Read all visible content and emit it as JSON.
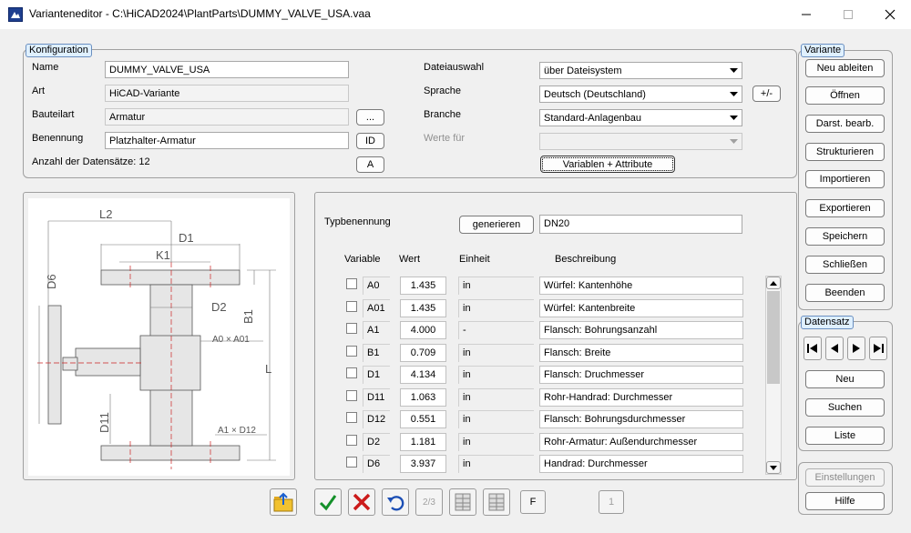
{
  "window": {
    "title": "Varianteneditor - C:\\HiCAD2024\\PlantParts\\DUMMY_VALVE_USA.vaa"
  },
  "konfiguration": {
    "group_label": "Konfiguration",
    "name_label": "Name",
    "name_value": "DUMMY_VALVE_USA",
    "art_label": "Art",
    "art_value": "HiCAD-Variante",
    "bauteilart_label": "Bauteilart",
    "bauteilart_value": "Armatur",
    "bauteilart_btn": "...",
    "benennung_label": "Benennung",
    "benennung_value": "Platzhalter-Armatur",
    "benennung_btn": "ID",
    "anzahl_label": "Anzahl der Datensätze: 12",
    "anzahl_btn": "A",
    "dateiauswahl_label": "Dateiauswahl",
    "dateiauswahl_value": "über Dateisystem",
    "sprache_label": "Sprache",
    "sprache_value": "Deutsch (Deutschland)",
    "sprache_btn": "+/-",
    "branche_label": "Branche",
    "branche_value": "Standard-Anlagenbau",
    "werte_label": "Werte für",
    "werte_value": "",
    "variablen_btn": "Variablen + Attribute"
  },
  "drawing": {
    "dims": [
      "L2",
      "D1",
      "K1",
      "D6",
      "D2",
      "B1",
      "A0 × A01",
      "L",
      "D11",
      "A1 × D12"
    ]
  },
  "variables": {
    "typ_label": "Typbenennung",
    "generieren_btn": "generieren",
    "typ_value": "DN20",
    "headers": {
      "variable": "Variable",
      "wert": "Wert",
      "einheit": "Einheit",
      "beschreibung": "Beschreibung"
    },
    "rows": [
      {
        "name": "A0",
        "value": "1.435",
        "unit": "in",
        "desc": "Würfel: Kantenhöhe"
      },
      {
        "name": "A01",
        "value": "1.435",
        "unit": "in",
        "desc": "Würfel: Kantenbreite"
      },
      {
        "name": "A1",
        "value": "4.000",
        "unit": "-",
        "desc": "Flansch: Bohrungsanzahl"
      },
      {
        "name": "B1",
        "value": "0.709",
        "unit": "in",
        "desc": "Flansch: Breite"
      },
      {
        "name": "D1",
        "value": "4.134",
        "unit": "in",
        "desc": "Flansch: Druchmesser"
      },
      {
        "name": "D11",
        "value": "1.063",
        "unit": "in",
        "desc": "Rohr-Handrad: Durchmesser"
      },
      {
        "name": "D12",
        "value": "0.551",
        "unit": "in",
        "desc": "Flansch: Bohrungsdurchmesser"
      },
      {
        "name": "D2",
        "value": "1.181",
        "unit": "in",
        "desc": "Rohr-Armatur: Außendurchmesser"
      },
      {
        "name": "D6",
        "value": "3.937",
        "unit": "in",
        "desc": "Handrad: Durchmesser"
      }
    ]
  },
  "toolbar": {
    "f_btn": "F",
    "n_btn": "1",
    "page_btn": "2/3"
  },
  "variante": {
    "group_label": "Variante",
    "buttons": [
      "Neu ableiten",
      "Öffnen",
      "Darst. bearb.",
      "Strukturieren",
      "Importieren",
      "Exportieren",
      "Speichern",
      "Schließen",
      "Beenden"
    ]
  },
  "datensatz": {
    "group_label": "Datensatz",
    "buttons": [
      "Neu",
      "Suchen",
      "Liste"
    ]
  },
  "bottom": {
    "einstellungen": "Einstellungen",
    "hilfe": "Hilfe"
  }
}
